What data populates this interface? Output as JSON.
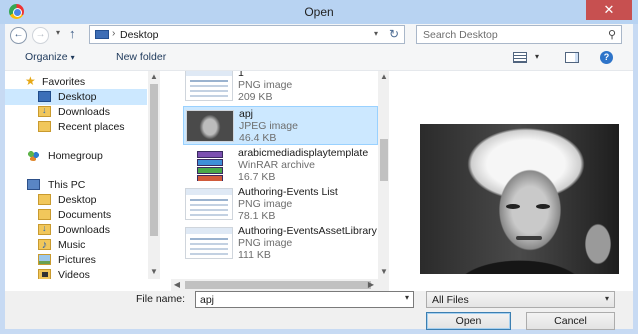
{
  "window": {
    "title": "Open",
    "close_glyph": "✕"
  },
  "navbar": {
    "back_glyph": "←",
    "forward_glyph": "→",
    "recent_glyph": "▾",
    "up_glyph": "↑",
    "address_chevron": "›",
    "address": "Desktop",
    "address_caret": "▾",
    "refresh_glyph": "↻",
    "search_placeholder": "Search Desktop",
    "search_glyph": "⚲"
  },
  "toolbar": {
    "organize_label": "Organize",
    "organize_caret": "▾",
    "new_folder_label": "New folder",
    "view_caret": "▾",
    "help_glyph": "?"
  },
  "nav_pane": {
    "favorites": [
      {
        "label": "Favorites",
        "icon": "star-icon"
      },
      {
        "label": "Desktop",
        "icon": "desktop-icon",
        "selected": true
      },
      {
        "label": "Downloads",
        "icon": "downloads-folder-icon"
      },
      {
        "label": "Recent places",
        "icon": "recent-places-icon"
      }
    ],
    "homegroup": {
      "label": "Homegroup",
      "icon": "homegroup-icon"
    },
    "this_pc": [
      {
        "label": "This PC",
        "icon": "computer-icon"
      },
      {
        "label": "Desktop",
        "icon": "folder-icon"
      },
      {
        "label": "Documents",
        "icon": "documents-folder-icon"
      },
      {
        "label": "Downloads",
        "icon": "downloads-folder-icon"
      },
      {
        "label": "Music",
        "icon": "music-folder-icon"
      },
      {
        "label": "Pictures",
        "icon": "pictures-folder-icon"
      },
      {
        "label": "Videos",
        "icon": "videos-folder-icon"
      }
    ],
    "scroll_up": "▲",
    "scroll_down": "▼"
  },
  "files": [
    {
      "name": "1",
      "type": "PNG image",
      "size": "209 KB",
      "thumb": "png",
      "selected": false
    },
    {
      "name": "apj",
      "type": "JPEG image",
      "size": "46.4 KB",
      "thumb": "photo",
      "selected": true
    },
    {
      "name": "arabicmediadisplaytemplate",
      "type": "WinRAR archive",
      "size": "16.7 KB",
      "thumb": "rar",
      "selected": false
    },
    {
      "name": "Authoring-Events List",
      "type": "PNG image",
      "size": "78.1 KB",
      "thumb": "png",
      "selected": false
    },
    {
      "name": "Authoring-EventsAssetLibrary",
      "type": "PNG image",
      "size": "111 KB",
      "thumb": "png",
      "selected": false
    }
  ],
  "file_scroll": {
    "up": "▲",
    "down": "▼",
    "left": "◀",
    "right": "▶"
  },
  "footer": {
    "file_name_label": "File name:",
    "file_name_value": "apj",
    "file_name_caret": "▾",
    "filter_value": "All Files",
    "filter_caret": "▾",
    "open_label": "Open",
    "cancel_label": "Cancel"
  },
  "colors": {
    "title_bar": "#b8d3f2",
    "close_button": "#c75050",
    "selection": "#cce8ff",
    "link_text": "#1e395b"
  }
}
